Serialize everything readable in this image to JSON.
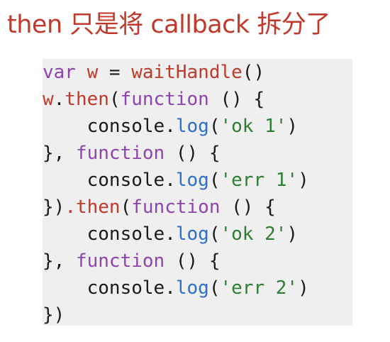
{
  "title": "then 只是将 callback 拆分了",
  "code": {
    "line1": {
      "kw": "var",
      "sp1": " ",
      "ident": "w",
      "rest": " = ",
      "func": "waitHandle",
      "tail": "()"
    },
    "line2": {
      "obj": "w",
      "dot": ".",
      "then": "then",
      "open": "(",
      "kw": "function",
      "tail": " () {"
    },
    "line3": {
      "indent": "    ",
      "obj": "console",
      "dot": ".",
      "method": "log",
      "open": "(",
      "str": "'ok 1'",
      "close": ")"
    },
    "line4": {
      "head": "}, ",
      "kw": "function",
      "tail": " () {"
    },
    "line5": {
      "indent": "    ",
      "obj": "console",
      "dot": ".",
      "method": "log",
      "open": "(",
      "str": "'err 1'",
      "close": ")"
    },
    "line6": {
      "head": "})",
      "dot": ".",
      "then": "then",
      "open": "(",
      "kw": "function",
      "tail": " () {"
    },
    "line7": {
      "indent": "    ",
      "obj": "console",
      "dot": ".",
      "method": "log",
      "open": "(",
      "str": "'ok 2'",
      "close": ")"
    },
    "line8": {
      "head": "}, ",
      "kw": "function",
      "tail": " () {"
    },
    "line9": {
      "indent": "    ",
      "obj": "console",
      "dot": ".",
      "method": "log",
      "open": "(",
      "str": "'err 2'",
      "close": ")"
    },
    "line10": {
      "text": "})"
    }
  },
  "colors": {
    "title": "#c0392b",
    "keyword": "#8e44ad",
    "variable": "#c0392b",
    "method": "#2e6fc9",
    "string": "#2e7d32",
    "code_background": "#efefef"
  }
}
